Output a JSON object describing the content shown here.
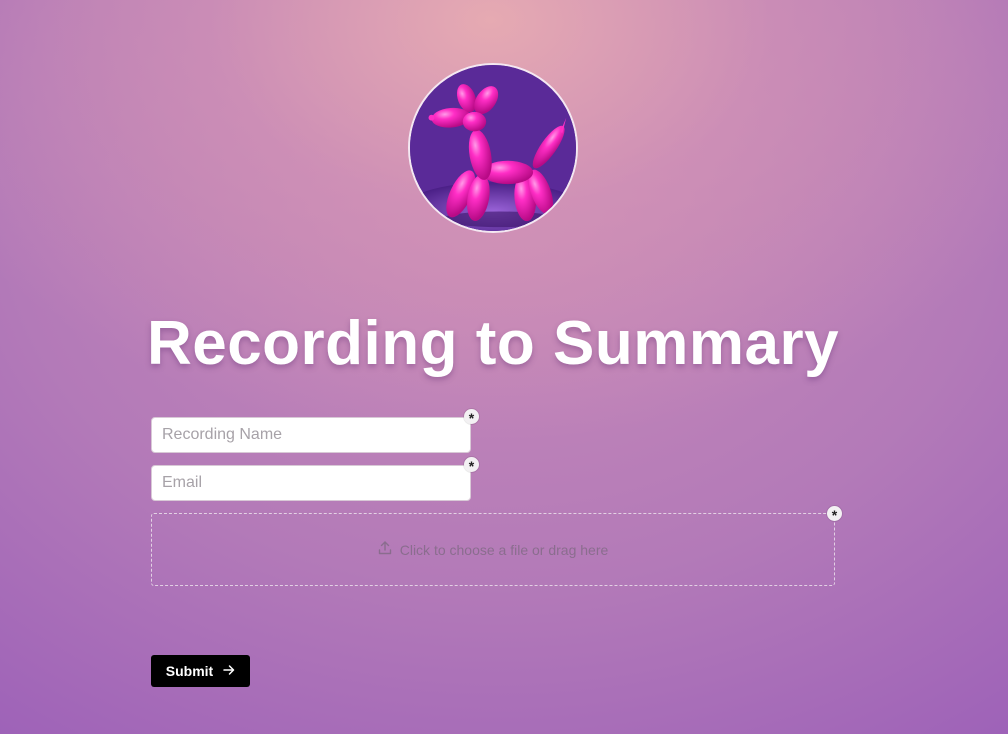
{
  "header": {
    "avatar_icon": "balloon-dog-image",
    "title": "Recording to Summary"
  },
  "form": {
    "recording_name": {
      "value": "",
      "placeholder": "Recording Name",
      "required_marker": "*"
    },
    "email": {
      "value": "",
      "placeholder": "Email",
      "required_marker": "*"
    },
    "file_upload": {
      "label": "Click to choose a file or drag here",
      "icon": "upload-icon",
      "required_marker": "*"
    },
    "submit": {
      "label": "Submit",
      "icon": "arrow-right-icon"
    }
  },
  "colors": {
    "title_text": "#ffffff",
    "submit_bg": "#000000",
    "background_top": "#e8acb2",
    "background_bottom": "#9b5fb8",
    "balloon": "#ff1fc0"
  }
}
